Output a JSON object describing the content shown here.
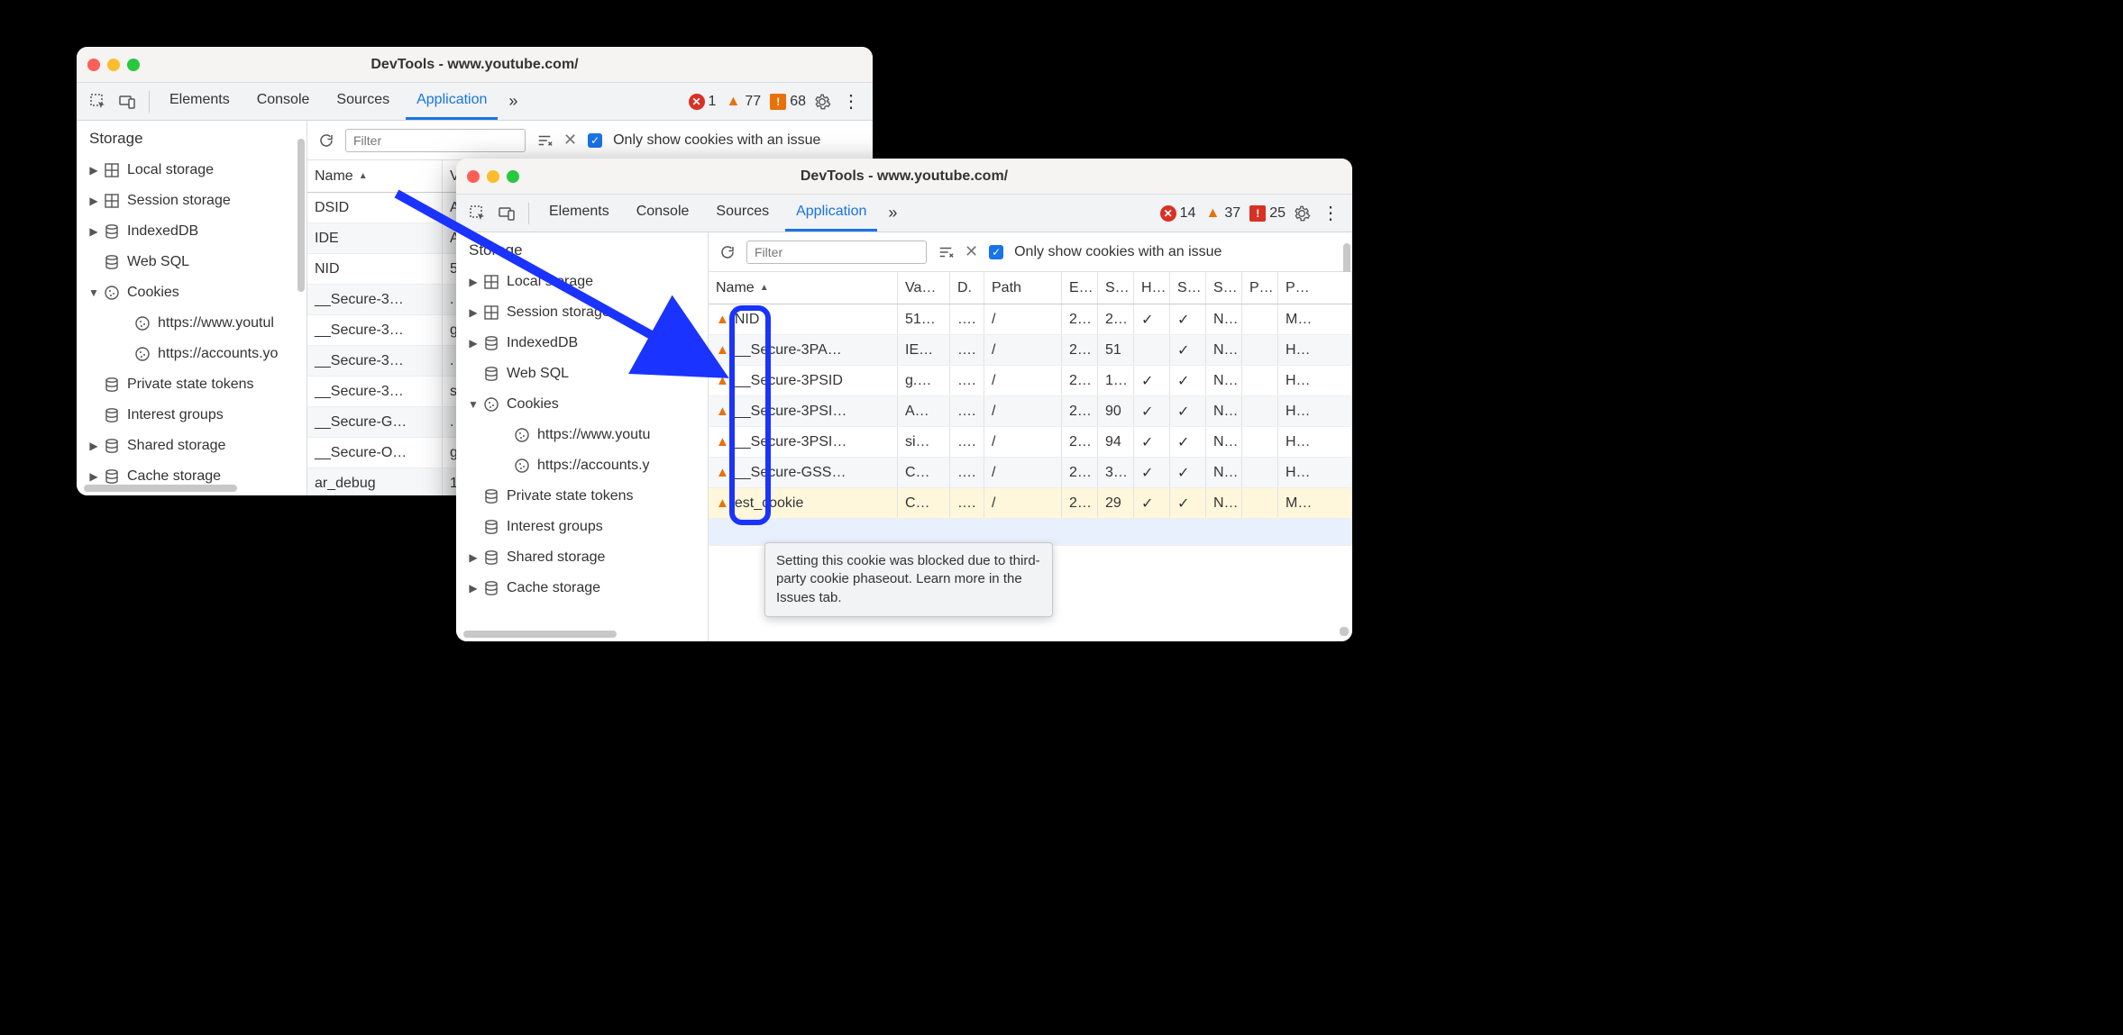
{
  "windows": {
    "A": {
      "title": "DevTools - www.youtube.com/",
      "tabs": [
        "Elements",
        "Console",
        "Sources",
        "Application"
      ],
      "active_tab": "Application",
      "badges": {
        "errors": "1",
        "warnings": "77",
        "messages": "68"
      },
      "filter_placeholder": "Filter",
      "only_label": "Only show cookies with an issue",
      "sidebar": {
        "section": "Storage",
        "items": [
          {
            "label": "Local storage",
            "icon": "grid",
            "disclosure": "▶",
            "indent": 0
          },
          {
            "label": "Session storage",
            "icon": "grid",
            "disclosure": "▶",
            "indent": 0
          },
          {
            "label": "IndexedDB",
            "icon": "db",
            "disclosure": "▶",
            "indent": 0
          },
          {
            "label": "Web SQL",
            "icon": "db",
            "disclosure": "",
            "indent": 0
          },
          {
            "label": "Cookies",
            "icon": "cookie",
            "disclosure": "▼",
            "indent": 0
          },
          {
            "label": "https://www.youtul",
            "icon": "cookie",
            "disclosure": "",
            "indent": 2
          },
          {
            "label": "https://accounts.yo",
            "icon": "cookie",
            "disclosure": "",
            "indent": 2
          },
          {
            "label": "Private state tokens",
            "icon": "db",
            "disclosure": "",
            "indent": 0
          },
          {
            "label": "Interest groups",
            "icon": "db",
            "disclosure": "",
            "indent": 0
          },
          {
            "label": "Shared storage",
            "icon": "db",
            "disclosure": "▶",
            "indent": 0
          },
          {
            "label": "Cache storage",
            "icon": "db",
            "disclosure": "▶",
            "indent": 0
          }
        ]
      },
      "columns": [
        "Name",
        "V"
      ],
      "rows": [
        {
          "name": "DSID",
          "v": "A"
        },
        {
          "name": "IDE",
          "v": "A"
        },
        {
          "name": "NID",
          "v": "5"
        },
        {
          "name": "__Secure-3…",
          "v": "."
        },
        {
          "name": "__Secure-3…",
          "v": "g"
        },
        {
          "name": "__Secure-3…",
          "v": "."
        },
        {
          "name": "__Secure-3…",
          "v": "s"
        },
        {
          "name": "__Secure-G…",
          "v": "."
        },
        {
          "name": "__Secure-O…",
          "v": "g"
        },
        {
          "name": "ar_debug",
          "v": "1"
        }
      ]
    },
    "B": {
      "title": "DevTools - www.youtube.com/",
      "tabs": [
        "Elements",
        "Console",
        "Sources",
        "Application"
      ],
      "active_tab": "Application",
      "badges": {
        "errors": "14",
        "warnings": "37",
        "messages": "25",
        "messages_red": true
      },
      "filter_placeholder": "Filter",
      "only_label": "Only show cookies with an issue",
      "sidebar": {
        "section": "Storage",
        "items": [
          {
            "label": "Local storage",
            "icon": "grid",
            "disclosure": "▶",
            "indent": 0
          },
          {
            "label": "Session storage",
            "icon": "grid",
            "disclosure": "▶",
            "indent": 0
          },
          {
            "label": "IndexedDB",
            "icon": "db",
            "disclosure": "▶",
            "indent": 0
          },
          {
            "label": "Web SQL",
            "icon": "db",
            "disclosure": "",
            "indent": 0
          },
          {
            "label": "Cookies",
            "icon": "cookie",
            "disclosure": "▼",
            "indent": 0
          },
          {
            "label": "https://www.youtu",
            "icon": "cookie",
            "disclosure": "",
            "indent": 2
          },
          {
            "label": "https://accounts.y",
            "icon": "cookie",
            "disclosure": "",
            "indent": 2
          },
          {
            "label": "Private state tokens",
            "icon": "db",
            "disclosure": "",
            "indent": 0
          },
          {
            "label": "Interest groups",
            "icon": "db",
            "disclosure": "",
            "indent": 0
          },
          {
            "label": "Shared storage",
            "icon": "db",
            "disclosure": "▶",
            "indent": 0
          },
          {
            "label": "Cache storage",
            "icon": "db",
            "disclosure": "▶",
            "indent": 0
          }
        ]
      },
      "col_heads": [
        "Name",
        "Va…",
        "D.",
        "Path",
        "E…",
        "S…",
        "H…",
        "S…",
        "S…",
        "P…",
        "P…"
      ],
      "rows": [
        {
          "w": true,
          "c": [
            "NID",
            "51…",
            "….",
            "/",
            "2…",
            "2…",
            "✓",
            "✓",
            "N…",
            "",
            "M…"
          ]
        },
        {
          "w": true,
          "c": [
            "__Secure-3PA…",
            "IE…",
            "….",
            "/",
            "2…",
            "51",
            "",
            "✓",
            "N…",
            "",
            "H…"
          ]
        },
        {
          "w": true,
          "c": [
            "__Secure-3PSID",
            "g.…",
            "….",
            "/",
            "2…",
            "1…",
            "✓",
            "✓",
            "N…",
            "",
            "H…"
          ]
        },
        {
          "w": true,
          "c": [
            "__Secure-3PSI…",
            "A…",
            "….",
            "/",
            "2…",
            "90",
            "✓",
            "✓",
            "N…",
            "",
            "H…"
          ]
        },
        {
          "w": true,
          "c": [
            "__Secure-3PSI…",
            "si…",
            "….",
            "/",
            "2…",
            "94",
            "✓",
            "✓",
            "N…",
            "",
            "H…"
          ]
        },
        {
          "w": true,
          "c": [
            "__Secure-GSS…",
            "C…",
            "….",
            "/",
            "2…",
            "3…",
            "✓",
            "✓",
            "N…",
            "",
            "H…"
          ]
        },
        {
          "w": true,
          "c": [
            "est_cookie",
            "C…",
            "….",
            "/",
            "2…",
            "29",
            "✓",
            "✓",
            "N…",
            "",
            "M…"
          ],
          "sel": true
        }
      ],
      "tooltip": "Setting this cookie was blocked due to third-party cookie phaseout. Learn more in the Issues tab."
    }
  }
}
